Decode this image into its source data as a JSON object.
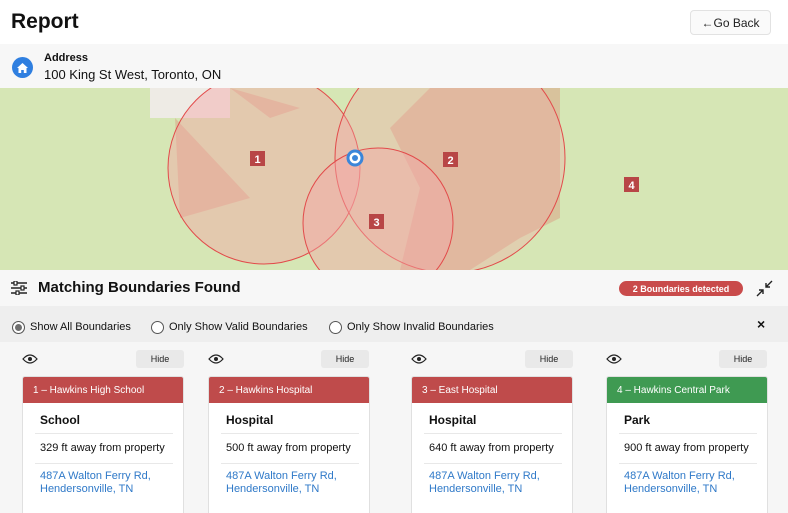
{
  "header": {
    "title": "Report",
    "go_back_label": "←Go Back"
  },
  "address": {
    "label": "Address",
    "value": "100 King St West, Toronto, ON"
  },
  "map": {
    "markers": [
      "1",
      "2",
      "3",
      "4"
    ],
    "colors": {
      "background": "#eeebe5",
      "green": "#d6e6b5",
      "tan": "#d8c29c",
      "pink_fill": "#f4a7a7",
      "boundary_stroke": "#e24a4a",
      "marker": "#b84646",
      "location": "#3b86d9"
    }
  },
  "matches": {
    "title": "Matching Boundaries Found",
    "badge": "2 Boundaries detected",
    "badge_color": "#c94b4b"
  },
  "filters": {
    "options": [
      "Show All Boundaries",
      "Only Show Valid Boundaries",
      "Only Show Invalid Boundaries"
    ],
    "selected": "Show All Boundaries",
    "close_label": "×"
  },
  "cards": [
    {
      "hide_label": "Hide",
      "header": "1 – Hawkins High School",
      "status": "invalid",
      "type": "School",
      "distance": "329 ft away from property",
      "address_line1": "487A Walton Ferry Rd,",
      "address_line2": "Hendersonville, TN"
    },
    {
      "hide_label": "Hide",
      "header": "2 – Hawkins Hospital",
      "status": "invalid",
      "type": "Hospital",
      "distance": "500 ft away from property",
      "address_line1": "487A Walton Ferry Rd,",
      "address_line2": "Hendersonville, TN"
    },
    {
      "hide_label": "Hide",
      "header": "3 – East Hospital",
      "status": "invalid",
      "type": "Hospital",
      "distance": "640 ft away from property",
      "address_line1": "487A Walton Ferry Rd,",
      "address_line2": "Hendersonville, TN"
    },
    {
      "hide_label": "Hide",
      "header": "4 – Hawkins Central Park",
      "status": "valid",
      "type": "Park",
      "distance": "900 ft away from property",
      "address_line1": "487A Walton Ferry Rd,",
      "address_line2": "Hendersonville, TN"
    }
  ],
  "colors": {
    "invalid_header": "#bf4b4b",
    "valid_header": "#3f9a52",
    "link": "#2f79c8"
  }
}
